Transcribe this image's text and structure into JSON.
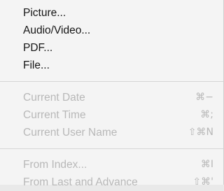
{
  "menu": {
    "group1": [
      {
        "label": "Picture..."
      },
      {
        "label": "Audio/Video..."
      },
      {
        "label": "PDF..."
      },
      {
        "label": "File..."
      }
    ],
    "group2": [
      {
        "label": "Current Date",
        "shortcut": "⌘−"
      },
      {
        "label": "Current Time",
        "shortcut": "⌘;"
      },
      {
        "label": "Current User Name",
        "shortcut": "⇧⌘N"
      }
    ],
    "group3": [
      {
        "label": "From Index...",
        "shortcut": "⌘I"
      },
      {
        "label": "From Last and Advance",
        "shortcut": "⇧⌘'"
      }
    ]
  },
  "colors": {
    "enabled_text": "#151515",
    "disabled_text": "#b8b8b8",
    "background": "#f4f4f4"
  }
}
